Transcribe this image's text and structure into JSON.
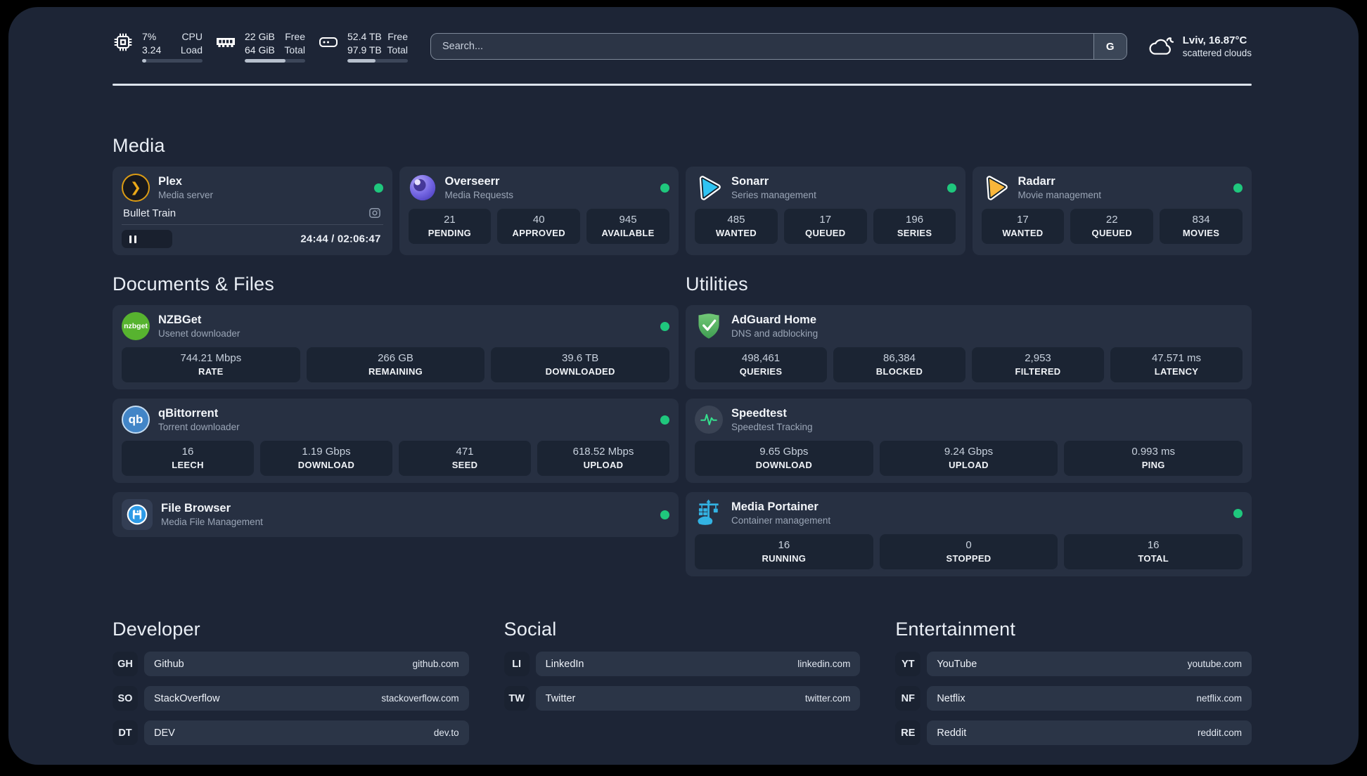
{
  "header": {
    "stats": [
      {
        "icon": "cpu-icon",
        "values": [
          "7%",
          "3.24"
        ],
        "labels": [
          "CPU",
          "Load"
        ],
        "progress_pct": 7
      },
      {
        "icon": "ram-icon",
        "values": [
          "22 GiB",
          "64 GiB"
        ],
        "labels": [
          "Free",
          "Total"
        ],
        "progress_pct": 68
      },
      {
        "icon": "disk-icon",
        "values": [
          "52.4 TB",
          "97.9 TB"
        ],
        "labels": [
          "Free",
          "Total"
        ],
        "progress_pct": 47
      }
    ],
    "search": {
      "placeholder": "Search...",
      "engine_label": "G"
    },
    "weather": {
      "location": "Lviv, 16.87°C",
      "condition": "scattered clouds"
    }
  },
  "sections": {
    "media": {
      "title": "Media",
      "plex": {
        "name": "Plex",
        "description": "Media server",
        "online": true,
        "now_playing": {
          "title": "Bullet Train",
          "time": "24:44 / 02:06:47",
          "progress_pct": 19.5
        }
      },
      "apps": [
        {
          "name": "Overseerr",
          "description": "Media Requests",
          "online": true,
          "stats": [
            {
              "value": "21",
              "label": "PENDING"
            },
            {
              "value": "40",
              "label": "APPROVED"
            },
            {
              "value": "945",
              "label": "AVAILABLE"
            }
          ]
        },
        {
          "name": "Sonarr",
          "description": "Series management",
          "online": true,
          "stats": [
            {
              "value": "485",
              "label": "WANTED"
            },
            {
              "value": "17",
              "label": "QUEUED"
            },
            {
              "value": "196",
              "label": "SERIES"
            }
          ]
        },
        {
          "name": "Radarr",
          "description": "Movie management",
          "online": true,
          "stats": [
            {
              "value": "17",
              "label": "WANTED"
            },
            {
              "value": "22",
              "label": "QUEUED"
            },
            {
              "value": "834",
              "label": "MOVIES"
            }
          ]
        }
      ]
    },
    "documents": {
      "title": "Documents & Files",
      "apps": [
        {
          "name": "NZBGet",
          "description": "Usenet downloader",
          "online": true,
          "stats": [
            {
              "value": "744.21 Mbps",
              "label": "RATE"
            },
            {
              "value": "266 GB",
              "label": "REMAINING"
            },
            {
              "value": "39.6 TB",
              "label": "DOWNLOADED"
            }
          ]
        },
        {
          "name": "qBittorrent",
          "description": "Torrent downloader",
          "online": true,
          "stats": [
            {
              "value": "16",
              "label": "LEECH"
            },
            {
              "value": "1.19 Gbps",
              "label": "DOWNLOAD"
            },
            {
              "value": "471",
              "label": "SEED"
            },
            {
              "value": "618.52 Mbps",
              "label": "UPLOAD"
            }
          ]
        },
        {
          "name": "File Browser",
          "description": "Media File Management",
          "online": true,
          "stats": []
        }
      ]
    },
    "utilities": {
      "title": "Utilities",
      "apps": [
        {
          "name": "AdGuard Home",
          "description": "DNS and adblocking",
          "online": false,
          "stats": [
            {
              "value": "498,461",
              "label": "QUERIES"
            },
            {
              "value": "86,384",
              "label": "BLOCKED"
            },
            {
              "value": "2,953",
              "label": "FILTERED"
            },
            {
              "value": "47.571 ms",
              "label": "LATENCY"
            }
          ]
        },
        {
          "name": "Speedtest",
          "description": "Speedtest Tracking",
          "online": false,
          "stats": [
            {
              "value": "9.65 Gbps",
              "label": "DOWNLOAD"
            },
            {
              "value": "9.24 Gbps",
              "label": "UPLOAD"
            },
            {
              "value": "0.993 ms",
              "label": "PING"
            }
          ]
        },
        {
          "name": "Media Portainer",
          "description": "Container management",
          "online": true,
          "stats": [
            {
              "value": "16",
              "label": "RUNNING"
            },
            {
              "value": "0",
              "label": "STOPPED"
            },
            {
              "value": "16",
              "label": "TOTAL"
            }
          ]
        }
      ]
    },
    "bookmarks": [
      {
        "title": "Developer",
        "items": [
          {
            "abbr": "GH",
            "label": "Github",
            "url": "github.com"
          },
          {
            "abbr": "SO",
            "label": "StackOverflow",
            "url": "stackoverflow.com"
          },
          {
            "abbr": "DT",
            "label": "DEV",
            "url": "dev.to"
          }
        ]
      },
      {
        "title": "Social",
        "items": [
          {
            "abbr": "LI",
            "label": "LinkedIn",
            "url": "linkedin.com"
          },
          {
            "abbr": "TW",
            "label": "Twitter",
            "url": "twitter.com"
          }
        ]
      },
      {
        "title": "Entertainment",
        "items": [
          {
            "abbr": "YT",
            "label": "YouTube",
            "url": "youtube.com"
          },
          {
            "abbr": "NF",
            "label": "Netflix",
            "url": "netflix.com"
          },
          {
            "abbr": "RE",
            "label": "Reddit",
            "url": "reddit.com"
          }
        ]
      }
    ]
  },
  "colors": {
    "status_online": "#1fc77d",
    "plex_orange": "#e0a015",
    "sonarr_blue": "#2fc4f3",
    "radarr_yellow": "#f9b63a",
    "nzbget_green": "#57b32f",
    "qbittorrent_blue": "#4285c7",
    "adguard_green": "#55b25c",
    "portainer_blue": "#33b3e3"
  }
}
